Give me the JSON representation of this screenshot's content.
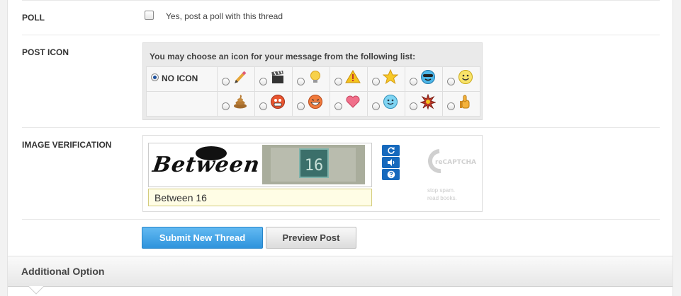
{
  "poll": {
    "label": "POLL",
    "checkbox_label": "Yes, post a poll with this thread",
    "checked": false
  },
  "post_icon": {
    "label": "POST ICON",
    "intro": "You may choose an icon for your message from the following list:",
    "no_icon_label": "NO ICON",
    "selected": "no-icon",
    "icons_row1": [
      "pencil-icon",
      "clapperboard-icon",
      "lightbulb-icon",
      "warning-icon",
      "star-icon",
      "cool-smiley-icon",
      "happy-smiley-icon"
    ],
    "icons_row2": [
      "poop-icon",
      "angry-smiley-icon",
      "laughing-smiley-icon",
      "heart-icon",
      "blue-smiley-icon",
      "burst-icon",
      "thumbs-up-icon"
    ]
  },
  "image_verification": {
    "label": "IMAGE VERIFICATION",
    "captcha_word": "Between",
    "captcha_number": "16",
    "input_value": "Between 16",
    "recaptcha_brand": "reCAPTCHA",
    "tagline_line1": "stop spam.",
    "tagline_line2": "read books."
  },
  "actions": {
    "submit_label": "Submit New Thread",
    "preview_label": "Preview Post"
  },
  "additional": {
    "title": "Additional Option"
  },
  "colors": {
    "submit_blue": "#2e93dc",
    "input_yellow": "#fffde5",
    "captcha_button_blue": "#1669bd"
  }
}
